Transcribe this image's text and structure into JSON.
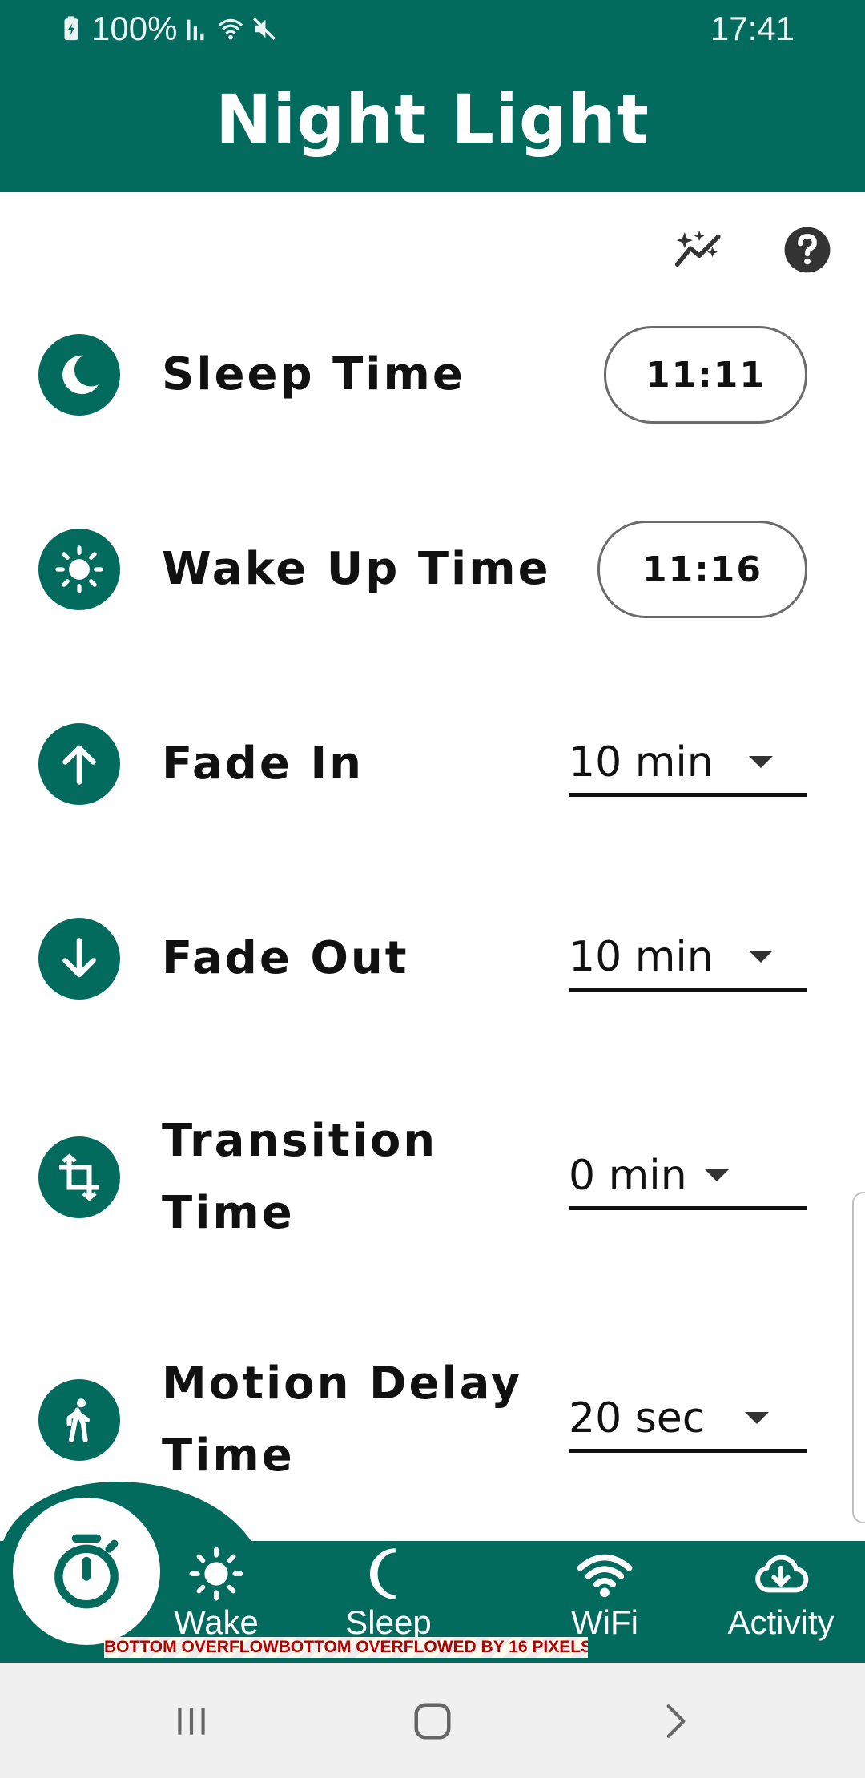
{
  "status_bar": {
    "battery": "100%",
    "time": "17:41"
  },
  "app_bar": {
    "title": "Night Light"
  },
  "toolbar": {
    "icons": [
      "auto-awesome-icon",
      "help-icon"
    ]
  },
  "settings": {
    "sleep": {
      "label": "Sleep Time",
      "value": "11:11",
      "icon": "moon-icon"
    },
    "wake": {
      "label": "Wake Up Time",
      "value": "11:16",
      "icon": "sun-icon"
    },
    "fade_in": {
      "label": "Fade In",
      "value": "10 min",
      "icon": "arrow-up-icon"
    },
    "fade_out": {
      "label": "Fade Out",
      "value": "10 min",
      "icon": "arrow-down-icon"
    },
    "transition": {
      "label_line1": "Transition",
      "label_line2": "Time",
      "value": "0 min",
      "icon": "crop-rotate-icon"
    },
    "motion": {
      "label_line1": "Motion Delay",
      "label_line2": "Time",
      "value": "20 sec",
      "icon": "walk-icon"
    }
  },
  "bottom_nav": {
    "wake": "Wake",
    "sleep": "Sleep",
    "wifi": "WiFi",
    "activity": "Activity",
    "fab_icon": "timer-icon"
  },
  "debug_banner": "BOTTOM OVERFLOWBOTTOM OVERFLOWED BY 16 PIXELS",
  "colors": {
    "primary": "#036b5e",
    "accent_text": "#111111",
    "overflow_text": "#b00000"
  }
}
